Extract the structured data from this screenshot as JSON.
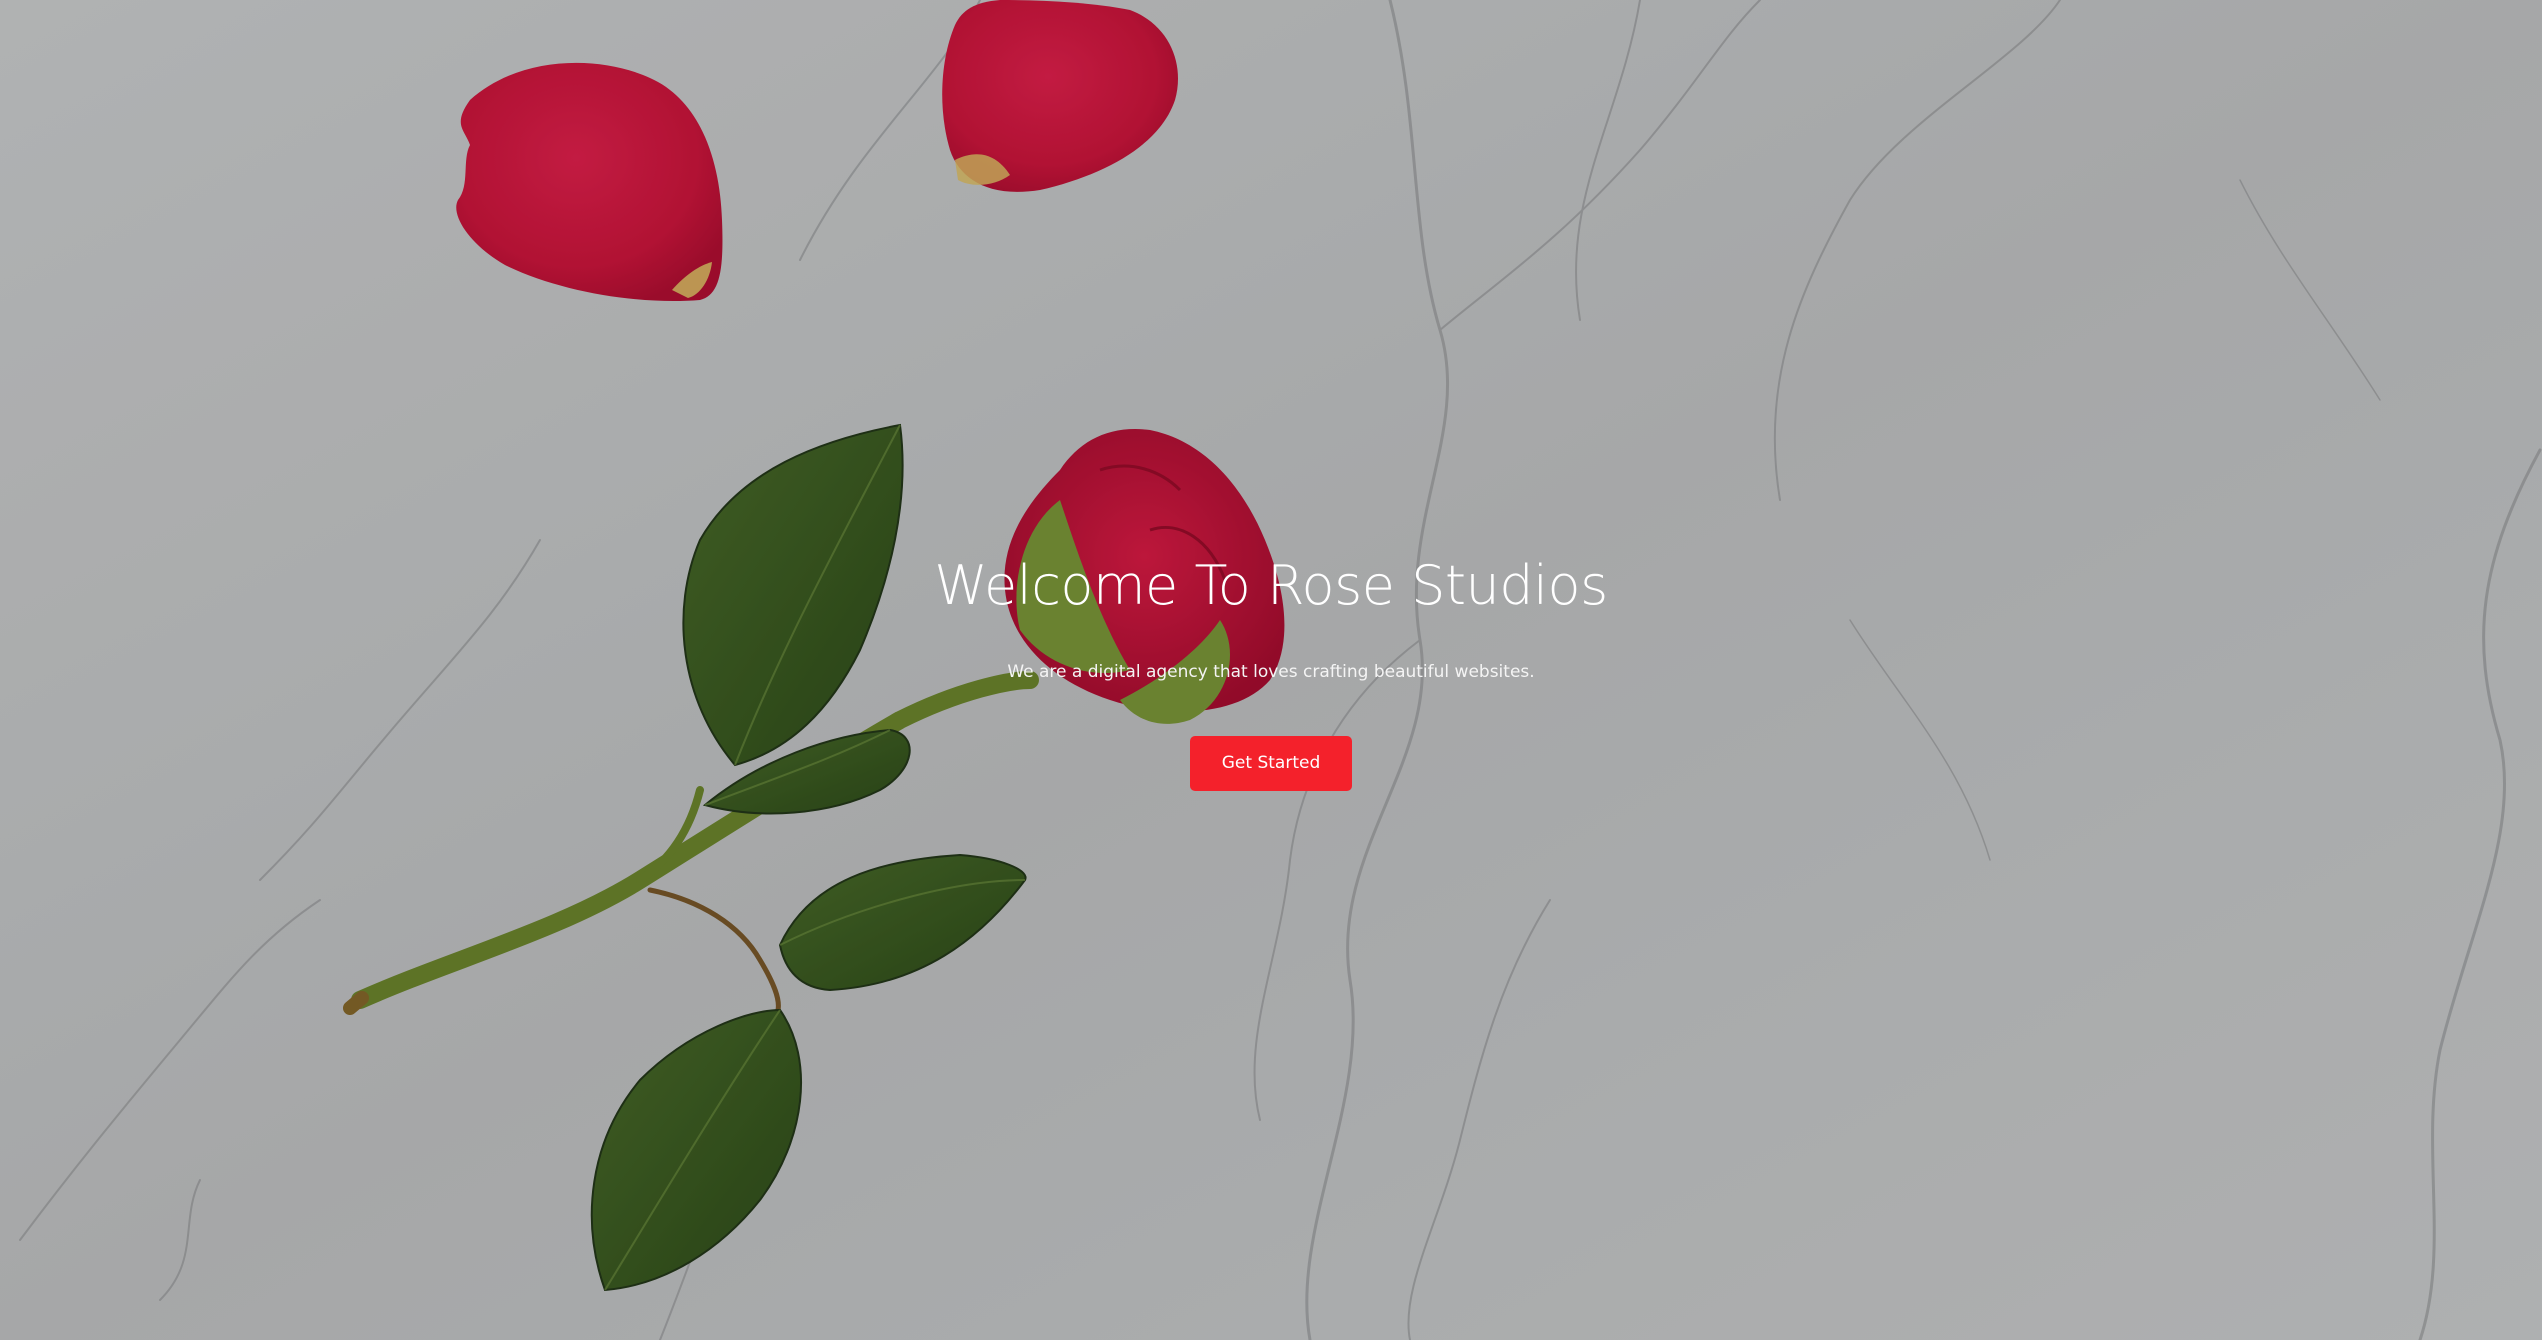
{
  "hero": {
    "title": "Welcome To Rose Studios",
    "subtitle": "We are a digital agency that loves crafting beautiful websites.",
    "cta_label": "Get Started",
    "background_image": "rose-on-marble-photo"
  },
  "colors": {
    "accent": "#f4212b",
    "text": "#ffffff",
    "marble": "#c7c9ca",
    "rose": "#d5153e",
    "leaf": "#3b5d22",
    "stem": "#6f8a2e"
  }
}
